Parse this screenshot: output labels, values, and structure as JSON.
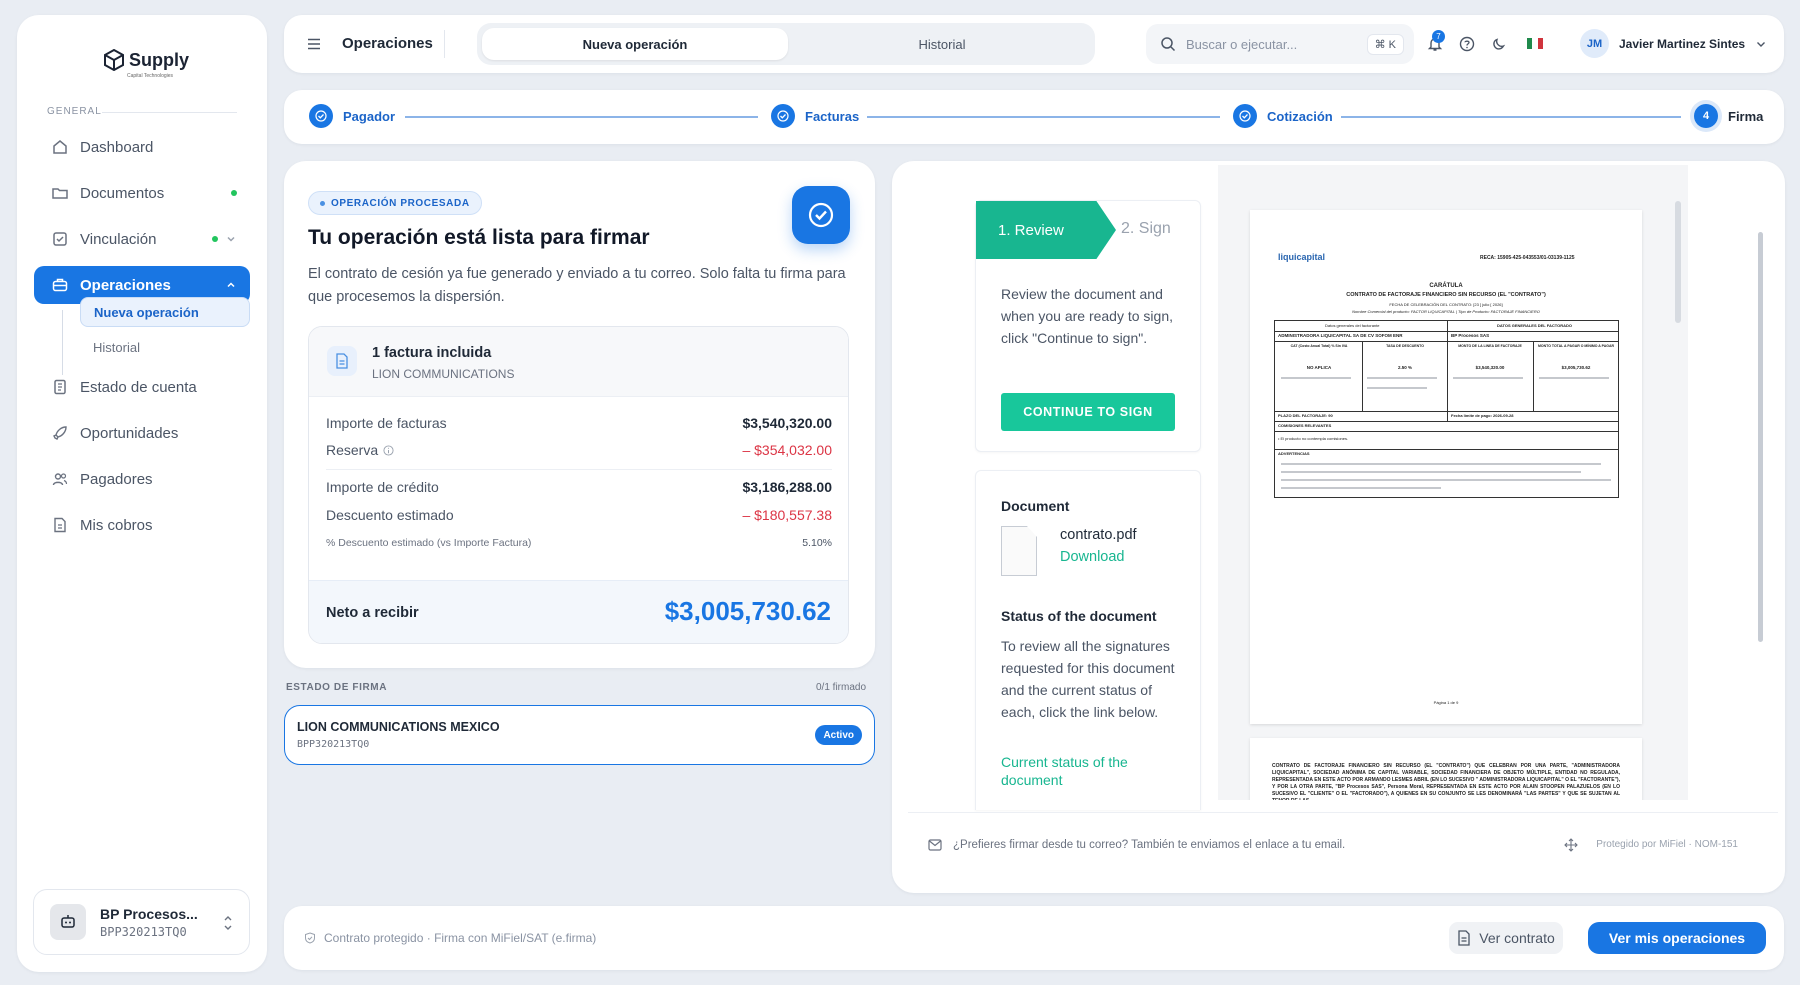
{
  "brand": {
    "name": "Supply",
    "subtitle": "Capital Technologies"
  },
  "sidebar": {
    "section": "GENERAL",
    "items": [
      {
        "label": "Dashboard",
        "icon": "home-icon"
      },
      {
        "label": "Documentos",
        "icon": "folder-icon",
        "dot": true
      },
      {
        "label": "Vinculación",
        "icon": "link-check-icon",
        "dot": true,
        "chevron": "down"
      },
      {
        "label": "Operaciones",
        "icon": "briefcase-icon",
        "active": true,
        "chevron": "up"
      },
      {
        "label": "Estado de cuenta",
        "icon": "ledger-icon"
      },
      {
        "label": "Oportunidades",
        "icon": "rocket-icon"
      },
      {
        "label": "Pagadores",
        "icon": "users-icon"
      },
      {
        "label": "Mis cobros",
        "icon": "receipt-icon"
      }
    ],
    "subitems": [
      {
        "label": "Nueva operación",
        "active": true
      },
      {
        "label": "Historial"
      }
    ],
    "account": {
      "name": "BP Procesos...",
      "id": "BPP320213TQ0"
    }
  },
  "topbar": {
    "title": "Operaciones",
    "tabs": [
      {
        "label": "Nueva operación",
        "active": true
      },
      {
        "label": "Historial"
      }
    ],
    "search_placeholder": "Buscar o ejecutar...",
    "shortcut": "⌘ K",
    "notifications": "7",
    "user": {
      "initials": "JM",
      "name": "Javier Martinez Sintes"
    }
  },
  "stepper": [
    {
      "label": "Pagador",
      "state": "done"
    },
    {
      "label": "Facturas",
      "state": "done"
    },
    {
      "label": "Cotización",
      "state": "done"
    },
    {
      "label": "Firma",
      "state": "current",
      "number": "4"
    }
  ],
  "summary": {
    "status": "OPERACIÓN PROCESADA",
    "title": "Tu operación está lista para firmar",
    "description": "El contrato de cesión ya fue generado y enviado a tu correo. Solo falta tu firma para que procesemos la dispersión.",
    "invoice_count": "1 factura incluida",
    "payer": "LION COMMUNICATIONS",
    "rows": {
      "importe_facturas": {
        "label": "Importe de facturas",
        "value": "$3,540,320.00"
      },
      "reserva": {
        "label": "Reserva",
        "value": "– $354,032.00"
      },
      "importe_credito": {
        "label": "Importe de crédito",
        "value": "$3,186,288.00"
      },
      "descuento": {
        "label": "Descuento estimado",
        "value": "– $180,557.38"
      },
      "pct_descuento": {
        "label": "% Descuento estimado (vs Importe Factura)",
        "value": "5.10%"
      }
    },
    "net": {
      "label": "Neto a recibir",
      "value": "$3,005,730.62"
    }
  },
  "firma": {
    "label": "ESTADO DE FIRMA",
    "count": "0/1 firmado",
    "signer": {
      "name": "LION COMMUNICATIONS MEXICO",
      "id": "BPP320213TQ0",
      "status": "Activo"
    }
  },
  "signing": {
    "tabs": {
      "review": "1. Review",
      "sign": "2. Sign"
    },
    "review_text": "Review the document and when you are ready to sign, click \"Continue to sign\".",
    "continue_button": "CONTINUE TO SIGN",
    "document_heading": "Document",
    "file_name": "contrato.pdf",
    "download": "Download",
    "status_heading": "Status of the document",
    "status_text": "To review all the signatures requested for this document and the current status of each, click the link below.",
    "status_link": "Current status of the document",
    "footer_text": "¿Prefieres firmar desde tu correo? También te enviamos el enlace a tu email.",
    "footer_right": "Protegido por MiFiel · NOM-151"
  },
  "preview": {
    "logo": "liquicapital",
    "reca": "RECA: 15905-425-043553/01-03139-1125",
    "heading": "CARÁTULA",
    "subheading": "CONTRATO DE FACTORAJE FINANCIERO SIN RECURSO (EL \"CONTRATO\")",
    "line1": "FECHA DE CELEBRACIÓN DEL CONTRATO: [23 ] julio [ 2026]",
    "line2": "Nombre Comercial del producto: FACTOR LIQUICAPITAL | Tipo de Producto: FACTORAJE FINANCIERO",
    "t_head_left": "Datos generales del factorante",
    "t_head_right": "DATOS GENERALES DEL FACTORADO",
    "t_party_left": "ADMINISTRADORA LIQUICAPITAL SA DE CV SOFOM ENR",
    "t_party_right": "BP Procesos SAS",
    "t_cols": [
      "CAT (Costo Anual Total) % Sin IVA",
      "TASA DE DESCUENTO",
      "MONTO DE LA LINEA DE FACTORAJE",
      "MONTO TOTAL A PAGAR O MÍNIMO A PAGAR"
    ],
    "t_vals": [
      "NO APLICA",
      "2.50 %",
      "$3,540,320.00",
      "$3,005,730.62"
    ],
    "plazo": "PLAZO DEL FACTORAJE: 90",
    "fecha_limite": "Fecha límite de pago: 2026-09-28",
    "comisiones": "COMISIONES RELEVANTES",
    "comisiones_item": "• El producto no contempla comisiones.",
    "advertencias": "ADVERTENCIAS",
    "page_num": "Página 1 de 9",
    "page2_text": "CONTRATO DE FACTORAJE FINANCIERO SIN RECURSO (EL \"CONTRATO\") QUE CELEBRAN POR UNA PARTE, \"ADMINISTRADORA LIQUICAPITAL\", SOCIEDAD ANÓNIMA DE CAPITAL VARIABLE, SOCIEDAD FINANCIERA DE OBJETO MÚLTIPLE, ENTIDAD NO REGULADA, REPRESENTADA EN ESTE ACTO POR ARMANDO LESMES ABRIL (EN LO SUCESIVO \" ADMINISTRADORA LIQUICAPITAL\" O EL \"FACTORANTE\"), Y POR LA OTRA PARTE, \"BP Procesos SAS\", Persona Moral, REPRESENTADA EN ESTE ACTO POR ALAIN STOOPEN PALAZUELOS (EN LO SUCESIVO EL \"CLIENTE\" O EL \"FACTORADO\"), A QUIENES EN SU CONJUNTO SE LES DENOMINARÁ \"LAS PARTES\" Y QUE SE SUJETAN AL TENOR DE LAS"
  },
  "bottombar": {
    "note": "Contrato protegido · Firma con MiFiel/SAT (e.firma)",
    "ver_contrato": "Ver contrato",
    "ver_operaciones": "Ver mis operaciones"
  },
  "colors": {
    "primary": "#1976e3",
    "mifiel_green": "#18b690",
    "negative": "#dc3545"
  }
}
